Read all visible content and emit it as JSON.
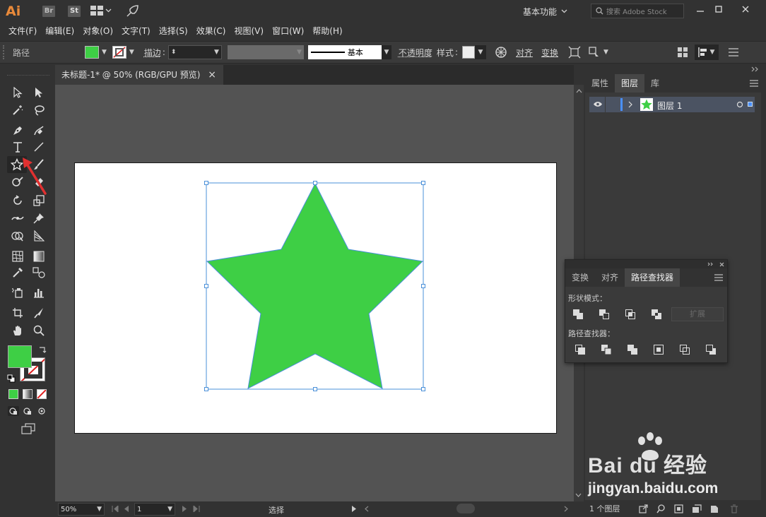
{
  "app": {
    "logo": "Ai",
    "bridge_badge": "Br",
    "stock_badge": "St",
    "workspace": "基本功能",
    "search_placeholder": "搜索 Adobe Stock"
  },
  "menu": [
    "文件(F)",
    "编辑(E)",
    "对象(O)",
    "文字(T)",
    "选择(S)",
    "效果(C)",
    "视图(V)",
    "窗口(W)",
    "帮助(H)"
  ],
  "control_bar": {
    "selection_type": "路径",
    "stroke_label": "描边",
    "stroke_profile": "基本",
    "opacity_label": "不透明度",
    "style_label": "样式",
    "align_label": "对齐",
    "transform_label": "变换"
  },
  "document": {
    "tab_title": "未标题-1* @ 50% (RGB/GPU 预览)",
    "close_glyph": "×"
  },
  "status_bar": {
    "zoom": "50%",
    "artboard_number": "1",
    "tool_status": "选择"
  },
  "right_panel": {
    "tabs": [
      "属性",
      "图层",
      "库"
    ],
    "active_tab": "图层",
    "layer_name": "图层 1",
    "footer_count": "1 个图层"
  },
  "pathfinder_panel": {
    "tabs": [
      "变换",
      "对齐",
      "路径查找器"
    ],
    "active_tab": "路径查找器",
    "shape_modes_label": "形状模式：",
    "expand_button": "扩展",
    "pathfinders_label": "路径查找器："
  },
  "watermark": {
    "brand": "Bai du 经验",
    "url": "jingyan.baidu.com"
  },
  "colors": {
    "fill": "#3ecf45",
    "selection": "#4a90d9",
    "artboard": "#ffffff",
    "canvas": "#535353",
    "accent": "#e98a3a",
    "annotation_arrow": "#e03030"
  }
}
